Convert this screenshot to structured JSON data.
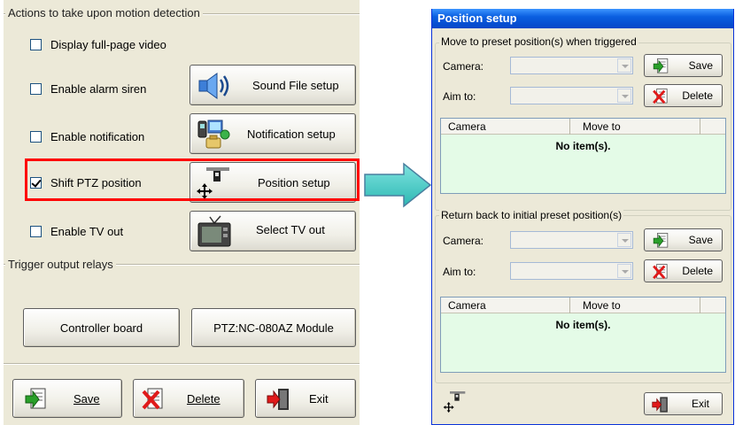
{
  "motion": {
    "group_title": "Actions to take upon motion detection",
    "options": [
      {
        "label": "Display full-page video",
        "checked": false
      },
      {
        "label": "Enable alarm siren",
        "checked": false
      },
      {
        "label": "Enable notification",
        "checked": false
      },
      {
        "label": "Shift PTZ position",
        "checked": true
      },
      {
        "label": "Enable TV out",
        "checked": false
      }
    ],
    "buttons": {
      "sound": "Sound File setup",
      "notification": "Notification setup",
      "position": "Position setup",
      "tv": "Select TV out"
    }
  },
  "relays": {
    "group_title": "Trigger output relays",
    "controller": "Controller board",
    "ptz_module": "PTZ:NC-080AZ Module"
  },
  "footer": {
    "save": "Save",
    "delete": "Delete",
    "exit": "Exit"
  },
  "dialog": {
    "title": "Position setup",
    "triggered": {
      "title": "Move to preset position(s) when triggered",
      "camera_label": "Camera:",
      "aim_label": "Aim to:",
      "save": "Save",
      "delete": "Delete",
      "col_camera": "Camera",
      "col_move": "Move to",
      "empty": "No item(s)."
    },
    "return_back": {
      "title": "Return back to initial preset position(s)",
      "camera_label": "Camera:",
      "aim_label": "Aim to:",
      "save": "Save",
      "delete": "Delete",
      "col_camera": "Camera",
      "col_move": "Move to",
      "empty": "No item(s)."
    },
    "exit": "Exit"
  },
  "colors": {
    "highlight": "#ff0000",
    "arrow": "#3cc9c4",
    "title_bar": "#0a5fe0",
    "table_bg": "#e4fbe7"
  }
}
